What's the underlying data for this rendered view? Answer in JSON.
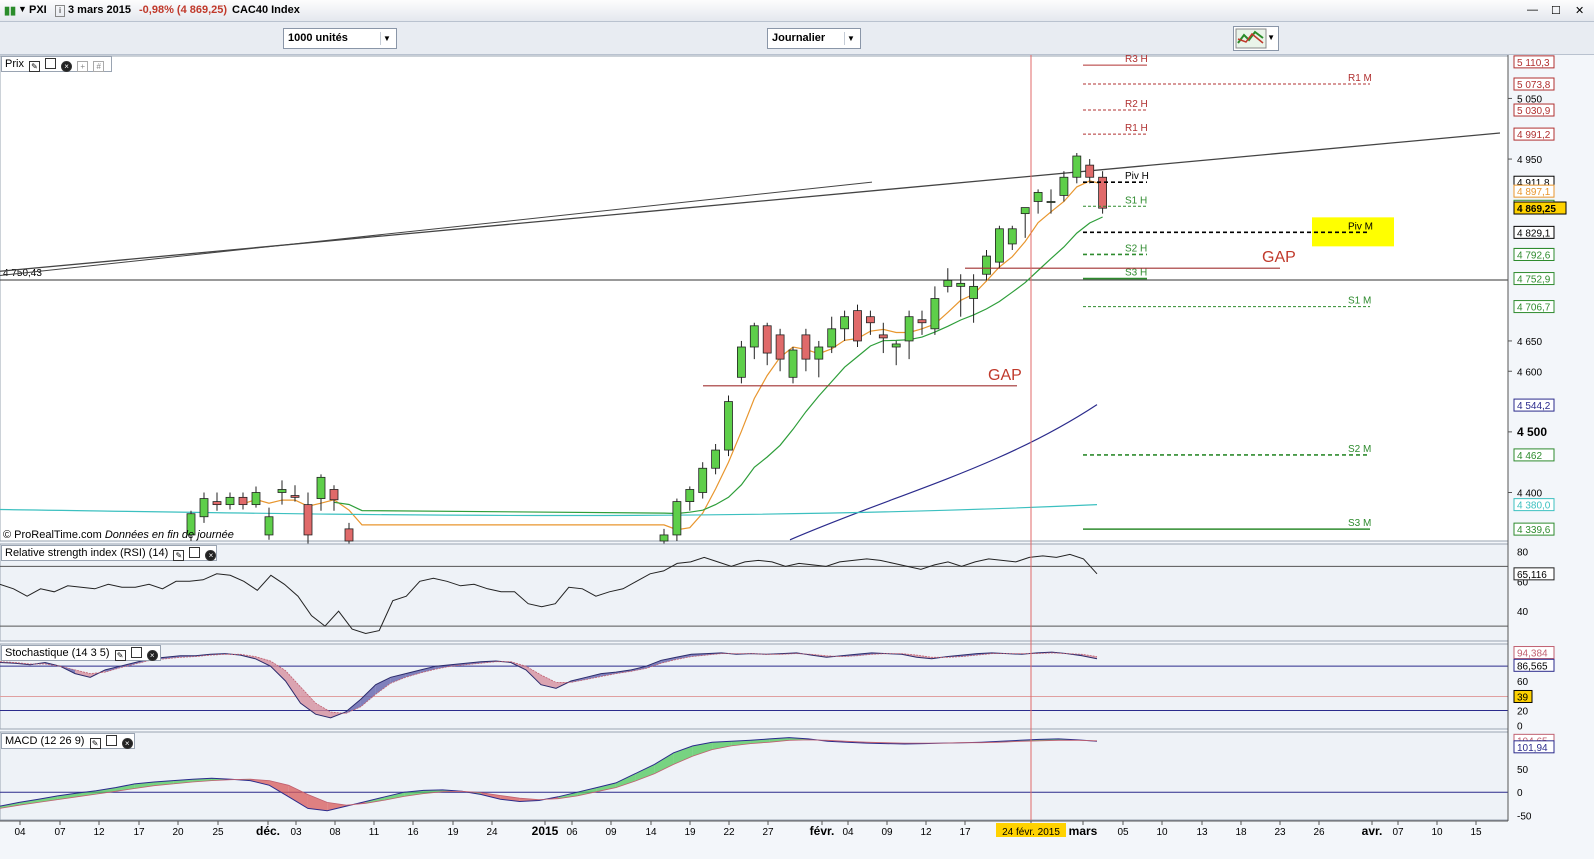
{
  "header": {
    "ticker": "PXI",
    "date": "3 mars 2015",
    "change": "-0,98% (4 869,25)",
    "instrument": "CAC40 Index",
    "window_min": "—",
    "window_max": "☐",
    "window_close": "✕"
  },
  "toolbar": {
    "units_value": "1000 unités",
    "period_value": "Journalier"
  },
  "colors": {
    "bull": "#5ecf4a",
    "bear": "#e06a6a",
    "accent_red": "#c0392b",
    "price_bg": "#ffffff",
    "panel_bg": "#eef2f7"
  },
  "copyright": {
    "site": "© ProRealTime.com",
    "note": "Données en fin de journée"
  },
  "chart_data": [
    {
      "type": "candlestick",
      "panel": "Prix",
      "title": "Prix",
      "ylim": [
        4320,
        5120
      ],
      "y_ticks": [
        "4 400",
        "4 500",
        "4 600",
        "4 650",
        "4 950",
        "5 050"
      ],
      "x_ticks": [
        "04",
        "07",
        "12",
        "17",
        "20",
        "25",
        "déc.",
        "03",
        "08",
        "11",
        "16",
        "19",
        "24",
        "2015",
        "06",
        "09",
        "14",
        "19",
        "22",
        "27",
        "févr.",
        "04",
        "09",
        "12",
        "17",
        "24 févr. 2015",
        "mars",
        "05",
        "10",
        "13",
        "18",
        "23",
        "26",
        "avr.",
        "07",
        "10",
        "15"
      ],
      "series": [
        {
          "values": [
            [
              4330,
              4370,
              4320,
              4365
            ],
            [
              4360,
              4400,
              4350,
              4390
            ],
            [
              4385,
              4400,
              4370,
              4380
            ],
            [
              4380,
              4400,
              4372,
              4392
            ],
            [
              4392,
              4400,
              4372,
              4380
            ],
            [
              4380,
              4410,
              4375,
              4400
            ],
            [
              4330,
              4375,
              4322,
              4360
            ],
            [
              4400,
              4420,
              4380,
              4405
            ],
            [
              4395,
              4412,
              4385,
              4392
            ],
            [
              4380,
              4400,
              4305,
              4330
            ],
            [
              4390,
              4430,
              4370,
              4425
            ],
            [
              4405,
              4412,
              4370,
              4388
            ],
            [
              4340,
              4350,
              4300,
              4320
            ],
            [
              4280,
              4290,
              4260,
              4270
            ],
            [
              4320,
              4340,
              4310,
              4330
            ],
            [
              4330,
              4390,
              4320,
              4385
            ],
            [
              4385,
              4410,
              4370,
              4405
            ],
            [
              4400,
              4450,
              4390,
              4440
            ],
            [
              4440,
              4480,
              4430,
              4470
            ],
            [
              4470,
              4560,
              4460,
              4550
            ],
            [
              4590,
              4650,
              4580,
              4640
            ],
            [
              4640,
              4680,
              4620,
              4675
            ],
            [
              4675,
              4680,
              4610,
              4630
            ],
            [
              4660,
              4670,
              4600,
              4620
            ],
            [
              4590,
              4640,
              4580,
              4635
            ],
            [
              4660,
              4670,
              4600,
              4620
            ],
            [
              4620,
              4650,
              4590,
              4640
            ],
            [
              4640,
              4690,
              4630,
              4670
            ],
            [
              4670,
              4700,
              4650,
              4690
            ],
            [
              4700,
              4710,
              4640,
              4650
            ],
            [
              4690,
              4700,
              4660,
              4680
            ],
            [
              4660,
              4680,
              4630,
              4655
            ],
            [
              4640,
              4650,
              4610,
              4645
            ],
            [
              4650,
              4700,
              4620,
              4690
            ],
            [
              4685,
              4700,
              4660,
              4680
            ],
            [
              4670,
              4740,
              4660,
              4720
            ],
            [
              4740,
              4770,
              4730,
              4750
            ],
            [
              4740,
              4760,
              4690,
              4745
            ],
            [
              4720,
              4760,
              4680,
              4740
            ],
            [
              4760,
              4800,
              4750,
              4790
            ],
            [
              4780,
              4840,
              4770,
              4835
            ],
            [
              4810,
              4840,
              4800,
              4835
            ],
            [
              4860,
              4870,
              4820,
              4870
            ],
            [
              4880,
              4900,
              4860,
              4895
            ],
            [
              4880,
              4900,
              4860,
              4880
            ],
            [
              4890,
              4930,
              4880,
              4920
            ],
            [
              4920,
              4960,
              4910,
              4955
            ],
            [
              4940,
              4950,
              4910,
              4920
            ],
            [
              4920,
              4930,
              4860,
              4869
            ]
          ]
        }
      ],
      "reference_line": {
        "value": 4750.43,
        "label": "4 750,43"
      },
      "pivot_labels": [
        "R3 H",
        "R1 H",
        "R2 H",
        "Piv H",
        "S1 H",
        "S2 H",
        "S3 H",
        "R1 M",
        "Piv M",
        "S1 M",
        "S2 M",
        "S3 M"
      ],
      "pivot_values": {
        "R3 H": 5105,
        "R2 H": 5030.9,
        "R1 H": 4991.2,
        "Piv H": 4911.8,
        "S1 H": 4872.1,
        "S2 H": 4792.7,
        "S3 H": 4752.9,
        "R1 M": 5073.8,
        "Piv M": 4829.1,
        "S1 M": 4706.7,
        "S2 M": 4462,
        "S3 M": 4339.6
      },
      "annotations": [
        "GAP",
        "GAP"
      ],
      "price_labels": [
        "5 110,3",
        "5 073,8",
        "5 030,9",
        "4 991,2",
        "4 911,8",
        "4 897,1",
        "4 872,1",
        "4 869,25",
        "4 829,1",
        "4 792,7",
        "4 792,6",
        "4 752,9",
        "4 706,7",
        "4 544,2",
        "4 462",
        "4 380,0",
        "4 339,6"
      ]
    },
    {
      "type": "line",
      "panel": "RSI",
      "title": "Relative strength index (RSI) (14)",
      "ylim": [
        20,
        85
      ],
      "y_ticks": [
        "80",
        "60",
        "40"
      ],
      "levels": [
        70,
        30
      ],
      "values": [
        58,
        55,
        50,
        55,
        53,
        57,
        56,
        55,
        58,
        56,
        56,
        58,
        55,
        60,
        60,
        61,
        65,
        64,
        60,
        54,
        64,
        58,
        50,
        37,
        30,
        40,
        28,
        25,
        27,
        47,
        50,
        60,
        62,
        60,
        57,
        58,
        55,
        53,
        53,
        45,
        43,
        45,
        56,
        55,
        50,
        53,
        55,
        60,
        65,
        67,
        72,
        73,
        76,
        73,
        70,
        73,
        74,
        73,
        70,
        72,
        71,
        70,
        73,
        74,
        75,
        74,
        72,
        70,
        68,
        71,
        73,
        70,
        73,
        75,
        74,
        73,
        76,
        77,
        76,
        78,
        75,
        65
      ],
      "current_value_label": "65,116"
    },
    {
      "type": "area",
      "panel": "Stochastique",
      "title": "Stochastique (14 3 5)",
      "ylim": [
        -5,
        110
      ],
      "y_ticks": [
        "60",
        "40",
        "20",
        "0"
      ],
      "levels": [
        80,
        20
      ],
      "values_k": [
        85,
        84,
        82,
        85,
        80,
        70,
        65,
        75,
        80,
        85,
        90,
        92,
        94,
        94,
        96,
        97,
        95,
        90,
        80,
        60,
        30,
        15,
        10,
        18,
        35,
        55,
        65,
        70,
        75,
        80,
        82,
        84,
        86,
        87,
        85,
        75,
        55,
        50,
        60,
        65,
        70,
        72,
        75,
        80,
        88,
        92,
        96,
        97,
        98,
        96,
        97,
        96,
        97,
        98,
        95,
        92,
        94,
        96,
        98,
        97,
        96,
        92,
        90,
        93,
        95,
        97,
        98,
        97,
        96,
        98,
        99,
        97,
        94,
        90
      ],
      "values_d": [
        86,
        85,
        83,
        83,
        80,
        75,
        70,
        72,
        78,
        83,
        88,
        90,
        92,
        93,
        95,
        96,
        96,
        93,
        87,
        74,
        52,
        30,
        18,
        16,
        25,
        42,
        57,
        65,
        71,
        76,
        80,
        82,
        84,
        86,
        86,
        80,
        68,
        58,
        58,
        62,
        66,
        70,
        73,
        77,
        84,
        89,
        93,
        95,
        97,
        97,
        97,
        96,
        96,
        97,
        96,
        94,
        93,
        94,
        96,
        97,
        97,
        95,
        92,
        92,
        93,
        95,
        97,
        97,
        97,
        97,
        98,
        97,
        96,
        93
      ],
      "current_value_labels": [
        "94,384",
        "86,565",
        "39"
      ]
    },
    {
      "type": "area",
      "panel": "MACD",
      "title": "MACD (12 26 9)",
      "ylim": [
        -60,
        130
      ],
      "y_ticks": [
        "50",
        "0",
        "-50"
      ],
      "values_macd": [
        -30,
        -22,
        -15,
        -8,
        -2,
        3,
        10,
        18,
        22,
        25,
        28,
        30,
        28,
        25,
        15,
        -10,
        -35,
        -40,
        -30,
        -20,
        -10,
        0,
        4,
        5,
        2,
        -5,
        -15,
        -20,
        -18,
        -10,
        0,
        10,
        20,
        40,
        60,
        85,
        100,
        108,
        110,
        112,
        115,
        118,
        115,
        110,
        108,
        106,
        105,
        104,
        105,
        106,
        107,
        108,
        110,
        112,
        114,
        115,
        113,
        110
      ],
      "values_signal": [
        -35,
        -28,
        -22,
        -16,
        -10,
        -4,
        2,
        8,
        14,
        18,
        22,
        25,
        27,
        28,
        25,
        15,
        -5,
        -22,
        -28,
        -24,
        -17,
        -9,
        -3,
        1,
        2,
        -1,
        -7,
        -13,
        -16,
        -14,
        -8,
        1,
        10,
        24,
        40,
        60,
        78,
        92,
        100,
        105,
        108,
        112,
        113,
        112,
        110,
        108,
        107,
        106,
        106,
        106,
        107,
        107,
        108,
        110,
        111,
        112,
        112,
        111
      ],
      "current_value_labels": [
        "104,65",
        "101,94"
      ]
    }
  ]
}
